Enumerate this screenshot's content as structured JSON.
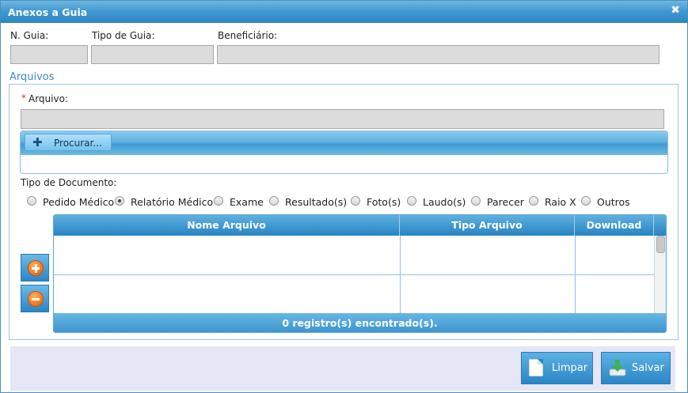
{
  "dialog": {
    "title": "Anexos a Guia",
    "close_glyph": "✖"
  },
  "header_fields": {
    "guia_label": "N. Guia:",
    "guia_value": "",
    "tipo_label": "Tipo de Guia:",
    "tipo_value": "",
    "beneficiario_label": "Beneficiário:",
    "beneficiario_value": ""
  },
  "arquivos": {
    "section_title": "Arquivos",
    "required_marker": "*",
    "arquivo_label": "Arquivo:",
    "arquivo_value": "",
    "browse_label": "Procurar...",
    "browse_icon": "plus-icon",
    "tipo_documento_label": "Tipo de Documento:",
    "tipo_documento_options": [
      {
        "label": "Pedido Médico",
        "checked": false
      },
      {
        "label": "Relatório Médico",
        "checked": true
      },
      {
        "label": "Exame",
        "checked": false
      },
      {
        "label": "Resultado(s)",
        "checked": false
      },
      {
        "label": "Foto(s)",
        "checked": false
      },
      {
        "label": "Laudo(s)",
        "checked": false
      },
      {
        "label": "Parecer",
        "checked": false
      },
      {
        "label": "Raio X",
        "checked": false
      },
      {
        "label": "Outros",
        "checked": false
      }
    ]
  },
  "grid": {
    "columns": [
      "Nome Arquivo",
      "Tipo Arquivo",
      "Download"
    ],
    "rows": [],
    "footer": "0 registro(s) encontrado(s)."
  },
  "side_buttons": {
    "add_icon": "add-circle-icon",
    "remove_icon": "remove-circle-icon"
  },
  "actions": {
    "limpar_label": "Limpar",
    "salvar_label": "Salvar"
  },
  "colors": {
    "accent": "#2f86c2",
    "header": "#3e97cf",
    "footer_bg": "#e6e6f7",
    "action_orange": "#f2741c"
  }
}
